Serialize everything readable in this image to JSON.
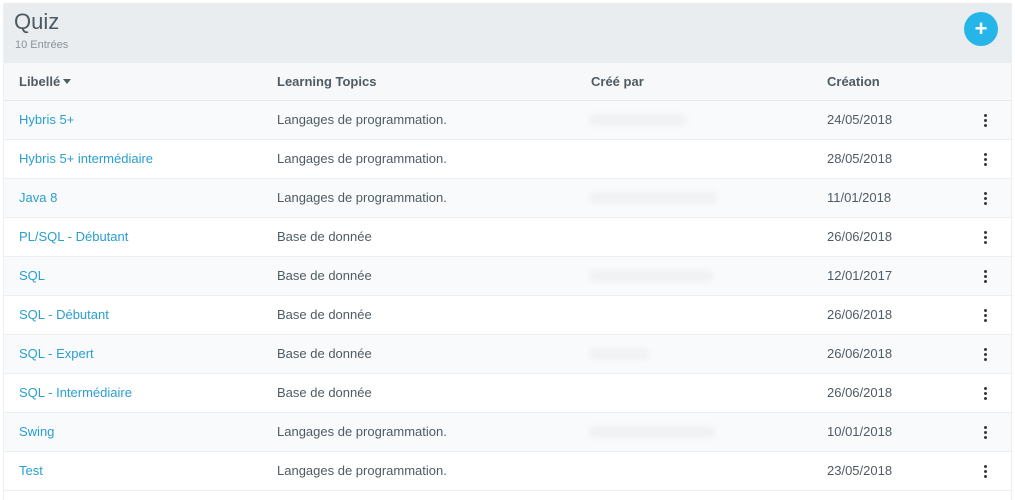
{
  "header": {
    "title": "Quiz",
    "count": "10 Entrées",
    "add_label": "+"
  },
  "columns": {
    "libelle": "Libellé",
    "topics": "Learning Topics",
    "creator": "Créé par",
    "date": "Création"
  },
  "rows": [
    {
      "libelle": "Hybris 5+",
      "topics": "Langages de programmation.",
      "date": "24/05/2018"
    },
    {
      "libelle": "Hybris 5+ intermédiaire",
      "topics": "Langages de programmation.",
      "date": "28/05/2018"
    },
    {
      "libelle": "Java 8",
      "topics": "Langages de programmation.",
      "date": "11/01/2018"
    },
    {
      "libelle": "PL/SQL - Débutant",
      "topics": "Base de donnée",
      "date": "26/06/2018"
    },
    {
      "libelle": "SQL",
      "topics": "Base de donnée",
      "date": "12/01/2017"
    },
    {
      "libelle": "SQL - Débutant",
      "topics": "Base de donnée",
      "date": "26/06/2018"
    },
    {
      "libelle": "SQL - Expert",
      "topics": "Base de donnée",
      "date": "26/06/2018"
    },
    {
      "libelle": "SQL - Intermédiaire",
      "topics": "Base de donnée",
      "date": "26/06/2018"
    },
    {
      "libelle": "Swing",
      "topics": "Langages de programmation.",
      "date": "10/01/2018"
    },
    {
      "libelle": "Test",
      "topics": "Langages de programmation.",
      "date": "23/05/2018"
    }
  ],
  "icons": {
    "add": "plus-icon",
    "sort": "caret-down-icon",
    "row_menu": "more-vertical-icon"
  },
  "colors": {
    "accent": "#26b5e8",
    "link": "#2a9fd0",
    "header_bg": "#e9edf0"
  }
}
